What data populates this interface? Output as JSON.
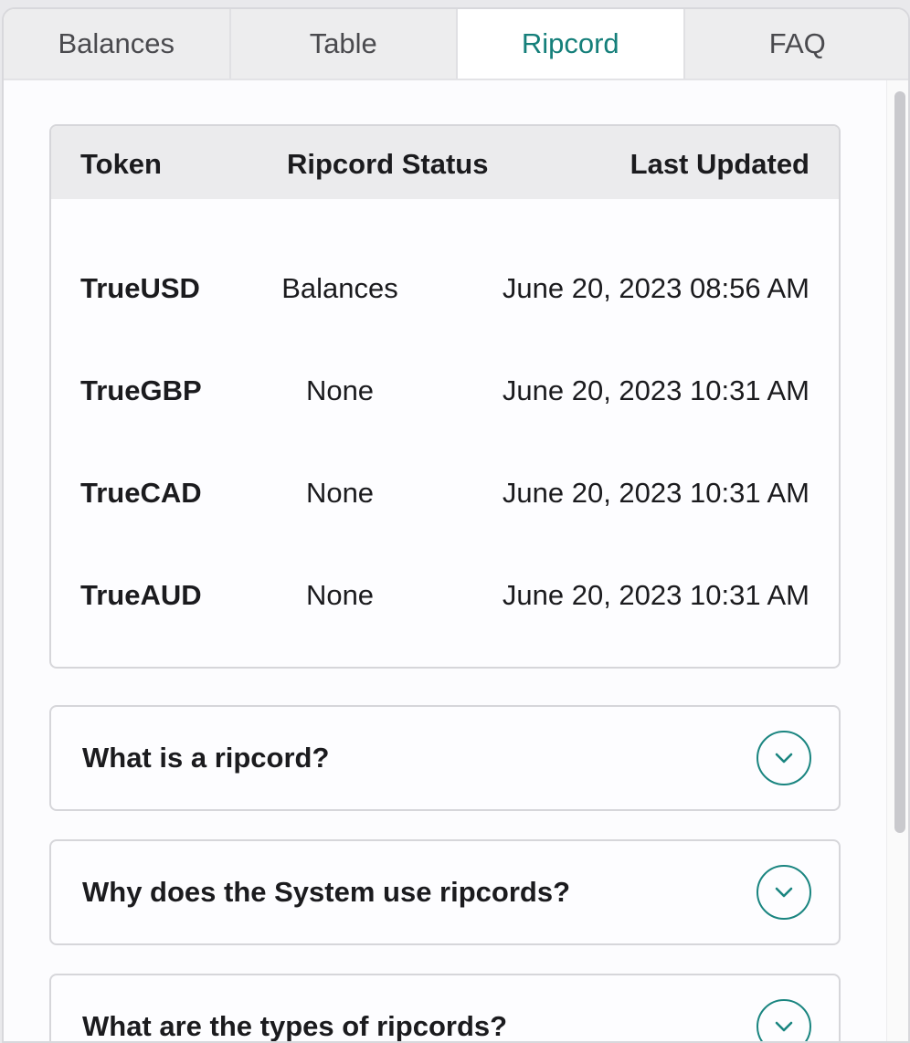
{
  "tabs": [
    {
      "label": "Balances",
      "active": false
    },
    {
      "label": "Table",
      "active": false
    },
    {
      "label": "Ripcord",
      "active": true
    },
    {
      "label": "FAQ",
      "active": false
    }
  ],
  "ripcord_table": {
    "headers": {
      "token": "Token",
      "status": "Ripcord Status",
      "updated": "Last Updated"
    },
    "rows": [
      {
        "token": "TrueUSD",
        "status": "Balances",
        "updated": "June 20, 2023 08:56 AM"
      },
      {
        "token": "TrueGBP",
        "status": "None",
        "updated": "June 20, 2023 10:31 AM"
      },
      {
        "token": "TrueCAD",
        "status": "None",
        "updated": "June 20, 2023 10:31 AM"
      },
      {
        "token": "TrueAUD",
        "status": "None",
        "updated": "June 20, 2023 10:31 AM"
      }
    ]
  },
  "faq": [
    {
      "question": "What is a ripcord?",
      "icon": "chevron-down-icon"
    },
    {
      "question": "Why does the System use ripcords?",
      "icon": "chevron-down-icon"
    },
    {
      "question": "What are the types of ripcords?",
      "icon": "chevron-down-icon"
    }
  ],
  "colors": {
    "accent": "#157f7a",
    "tab_bg": "#ededee",
    "header_bg": "#ebebed",
    "border": "#d6d6da"
  }
}
